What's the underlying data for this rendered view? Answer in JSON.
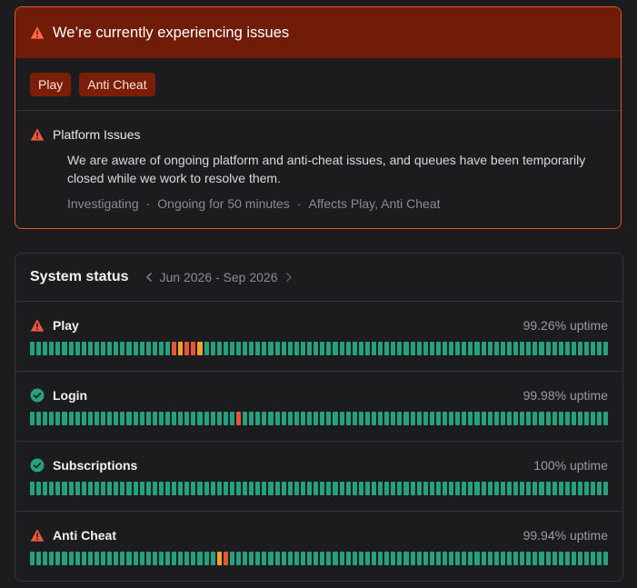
{
  "colors": {
    "accent_red": "#e0592f",
    "header_bg": "#711c08",
    "ok_green": "#26a17d",
    "degraded_orange": "#f2a22c",
    "outage_red": "#e3553c"
  },
  "incident": {
    "title": "We’re currently experiencing issues",
    "icon": "warning-icon",
    "tags": [
      "Play",
      "Anti Cheat"
    ],
    "update": {
      "title": "Platform Issues",
      "icon": "warning-icon",
      "body": "We are aware of ongoing platform and anti-cheat issues, and queues have been temporarily closed while we work to resolve them.",
      "status": "Investigating",
      "duration": "Ongoing for 50 minutes",
      "affects": "Affects Play, Anti Cheat",
      "separator": "·"
    }
  },
  "system_status": {
    "title": "System status",
    "range": "Jun 2026 - Sep 2026",
    "components": [
      {
        "name": "Play",
        "icon": "warning-icon",
        "uptime": "99.26% uptime",
        "days": "ggggggggggggggggggggggrorrogggggggggggggggggggggggggggggggggggggggggggggggggggggggggggggggrgggggggoggoor"
      },
      {
        "name": "Login",
        "icon": "check-circle-icon",
        "uptime": "99.98% uptime",
        "days": "ggggggggggggggggggggggggggggggggrggggggggggggggggggggggggggggggggggggggggggggggggggggggggggg"
      },
      {
        "name": "Subscriptions",
        "icon": "check-circle-icon",
        "uptime": "100% uptime",
        "days": "gggggggggggggggggggggggggggggggggggggggggggggggggggggggggggggggggggggggggggggggggggggggggggg"
      },
      {
        "name": "Anti Cheat",
        "icon": "warning-icon",
        "uptime": "99.94% uptime",
        "days": "gggggggggggggggggggggggggggggorggggggggggggggggggggggggggggggggggggggggggggggggggggggggggggr"
      }
    ]
  }
}
